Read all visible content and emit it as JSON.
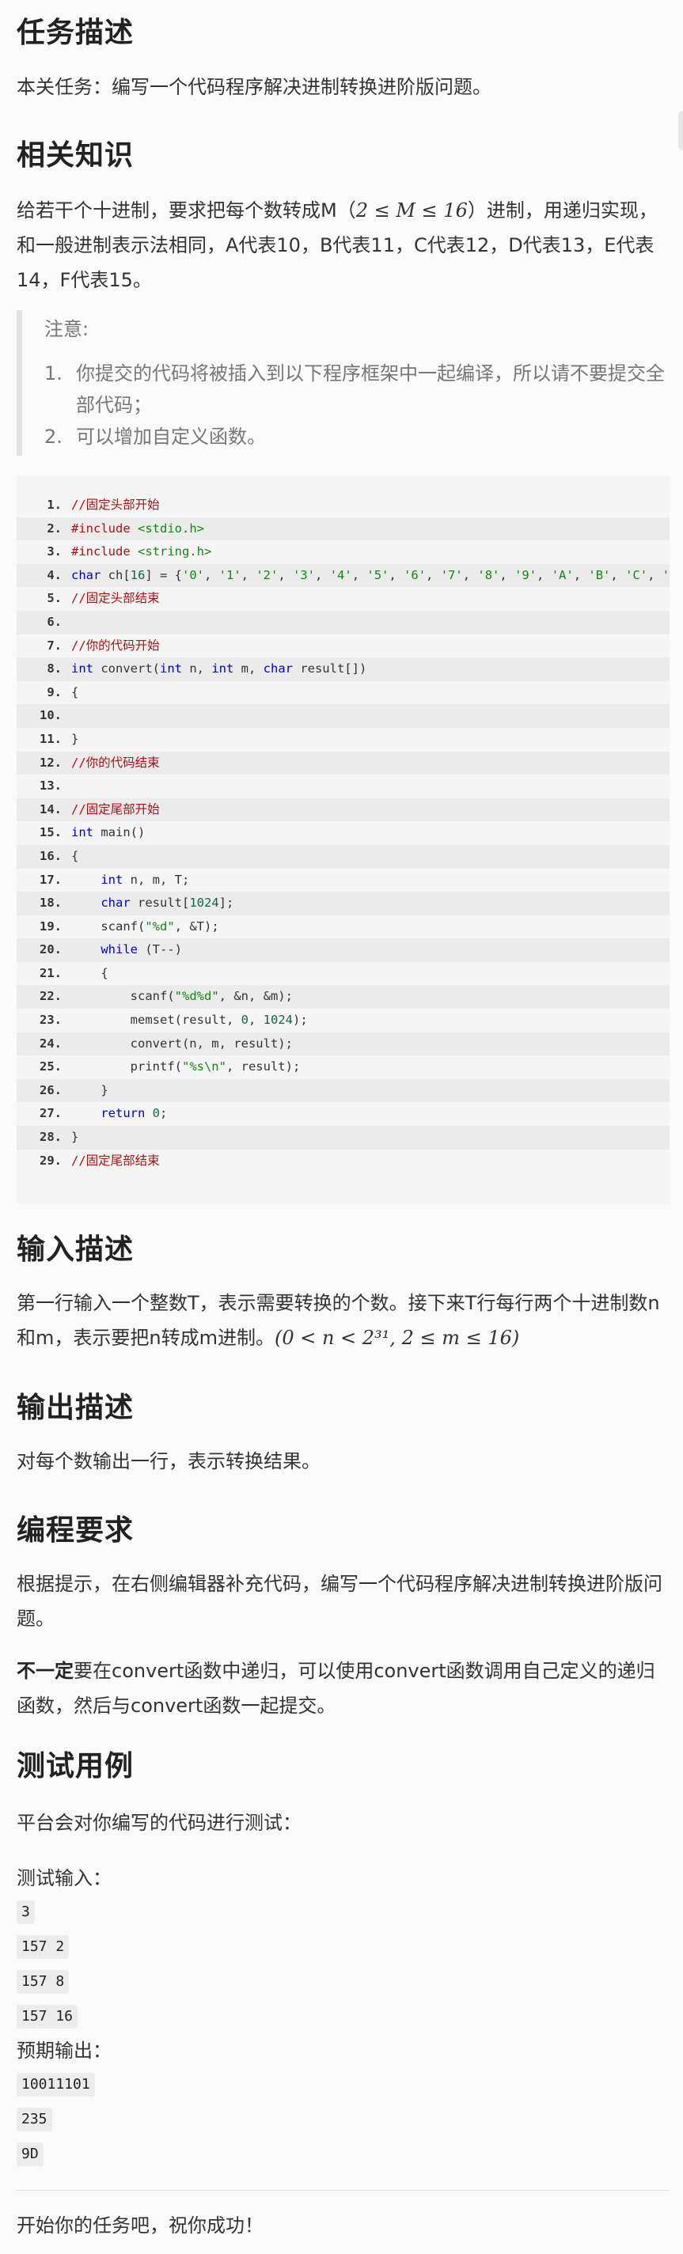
{
  "sections": {
    "task_title": "任务描述",
    "task_text": "本关任务：编写一个代码程序解决进制转换进阶版问题。",
    "knowledge_title": "相关知识",
    "knowledge_text_a": "给若干个十进制，要求把每个数转成M（",
    "knowledge_math": "2 ≤ M ≤ 16",
    "knowledge_text_b": "）进制，用递归实现，和一般进制表示法相同，A代表10，B代表11，C代表12，D代表13，E代表14，F代表15。",
    "note_title": "注意:",
    "note_items": [
      {
        "num": "1.",
        "text": "你提交的代码将被插入到以下程序框架中一起编译，所以请不要提交全部代码；"
      },
      {
        "num": "2.",
        "text": "可以增加自定义函数。"
      }
    ],
    "input_title": "输入描述",
    "input_text": "第一行输入一个整数T，表示需要转换的个数。接下来T行每行两个十进制数n和m，表示要把n转成m进制。",
    "input_math": "(0 < n < 2³¹,   2 ≤ m ≤ 16)",
    "output_title": "输出描述",
    "output_text": "对每个数输出一行，表示转换结果。",
    "req_title": "编程要求",
    "req_text": "根据提示，在右侧编辑器补充代码，编写一个代码程序解决进制转换进阶版问题。",
    "req2_bold": "不一定",
    "req2_text": "要在convert函数中递归，可以使用convert函数调用自己定义的递归函数，然后与convert函数一起提交。",
    "test_title": "测试用例",
    "test_text": "平台会对你编写的代码进行测试：",
    "test_input_label": "测试输入：",
    "test_inputs": [
      "3",
      "157 2",
      "157 8",
      "157 16"
    ],
    "expected_label": "预期输出：",
    "expected_outputs": [
      "10011101",
      "235",
      "9D"
    ],
    "end_text": "开始你的任务吧，祝你成功！"
  },
  "code_lines": [
    [
      [
        "c",
        "//固定头部开始"
      ]
    ],
    [
      [
        "pp",
        "#include "
      ],
      [
        "s",
        "<stdio.h>"
      ]
    ],
    [
      [
        "pp",
        "#include "
      ],
      [
        "s",
        "<string.h>"
      ]
    ],
    [
      [
        "k",
        "char"
      ],
      [
        "t",
        " ch["
      ],
      [
        "n",
        "16"
      ],
      [
        "t",
        "] = {"
      ],
      [
        "s",
        "'0'"
      ],
      [
        "t",
        ", "
      ],
      [
        "s",
        "'1'"
      ],
      [
        "t",
        ", "
      ],
      [
        "s",
        "'2'"
      ],
      [
        "t",
        ", "
      ],
      [
        "s",
        "'3'"
      ],
      [
        "t",
        ", "
      ],
      [
        "s",
        "'4'"
      ],
      [
        "t",
        ", "
      ],
      [
        "s",
        "'5'"
      ],
      [
        "t",
        ", "
      ],
      [
        "s",
        "'6'"
      ],
      [
        "t",
        ", "
      ],
      [
        "s",
        "'7'"
      ],
      [
        "t",
        ", "
      ],
      [
        "s",
        "'8'"
      ],
      [
        "t",
        ", "
      ],
      [
        "s",
        "'9'"
      ],
      [
        "t",
        ", "
      ],
      [
        "s",
        "'A'"
      ],
      [
        "t",
        ", "
      ],
      [
        "s",
        "'B'"
      ],
      [
        "t",
        ", "
      ],
      [
        "s",
        "'C'"
      ],
      [
        "t",
        ", "
      ],
      [
        "s",
        "'D'"
      ]
    ],
    [
      [
        "c",
        "//固定头部结束"
      ]
    ],
    [],
    [
      [
        "c",
        "//你的代码开始"
      ]
    ],
    [
      [
        "k",
        "int"
      ],
      [
        "t",
        " convert("
      ],
      [
        "k",
        "int"
      ],
      [
        "t",
        " n, "
      ],
      [
        "k",
        "int"
      ],
      [
        "t",
        " m, "
      ],
      [
        "k",
        "char"
      ],
      [
        "t",
        " result[])"
      ]
    ],
    [
      [
        "t",
        "{"
      ]
    ],
    [],
    [
      [
        "t",
        "}"
      ]
    ],
    [
      [
        "c",
        "//你的代码结束"
      ]
    ],
    [],
    [
      [
        "c",
        "//固定尾部开始"
      ]
    ],
    [
      [
        "k",
        "int"
      ],
      [
        "t",
        " main()"
      ]
    ],
    [
      [
        "t",
        "{"
      ]
    ],
    [
      [
        "t",
        "    "
      ],
      [
        "k",
        "int"
      ],
      [
        "t",
        " n, m, T;"
      ]
    ],
    [
      [
        "t",
        "    "
      ],
      [
        "k",
        "char"
      ],
      [
        "t",
        " result["
      ],
      [
        "n",
        "1024"
      ],
      [
        "t",
        "];"
      ]
    ],
    [
      [
        "t",
        "    scanf("
      ],
      [
        "s",
        "\"%d\""
      ],
      [
        "t",
        ", &T);"
      ]
    ],
    [
      [
        "t",
        "    "
      ],
      [
        "k",
        "while"
      ],
      [
        "t",
        " (T--)"
      ]
    ],
    [
      [
        "t",
        "    {"
      ]
    ],
    [
      [
        "t",
        "        scanf("
      ],
      [
        "s",
        "\"%d%d\""
      ],
      [
        "t",
        ", &n, &m);"
      ]
    ],
    [
      [
        "t",
        "        memset(result, "
      ],
      [
        "n",
        "0"
      ],
      [
        "t",
        ", "
      ],
      [
        "n",
        "1024"
      ],
      [
        "t",
        ");"
      ]
    ],
    [
      [
        "t",
        "        convert(n, m, result);"
      ]
    ],
    [
      [
        "t",
        "        printf("
      ],
      [
        "s",
        "\"%s\\n\""
      ],
      [
        "t",
        ", result);"
      ]
    ],
    [
      [
        "t",
        "    }"
      ]
    ],
    [
      [
        "t",
        "    "
      ],
      [
        "k",
        "return"
      ],
      [
        "t",
        " "
      ],
      [
        "n",
        "0"
      ],
      [
        "t",
        ";"
      ]
    ],
    [
      [
        "t",
        "}"
      ]
    ],
    [
      [
        "c",
        "//固定尾部结束"
      ]
    ]
  ]
}
